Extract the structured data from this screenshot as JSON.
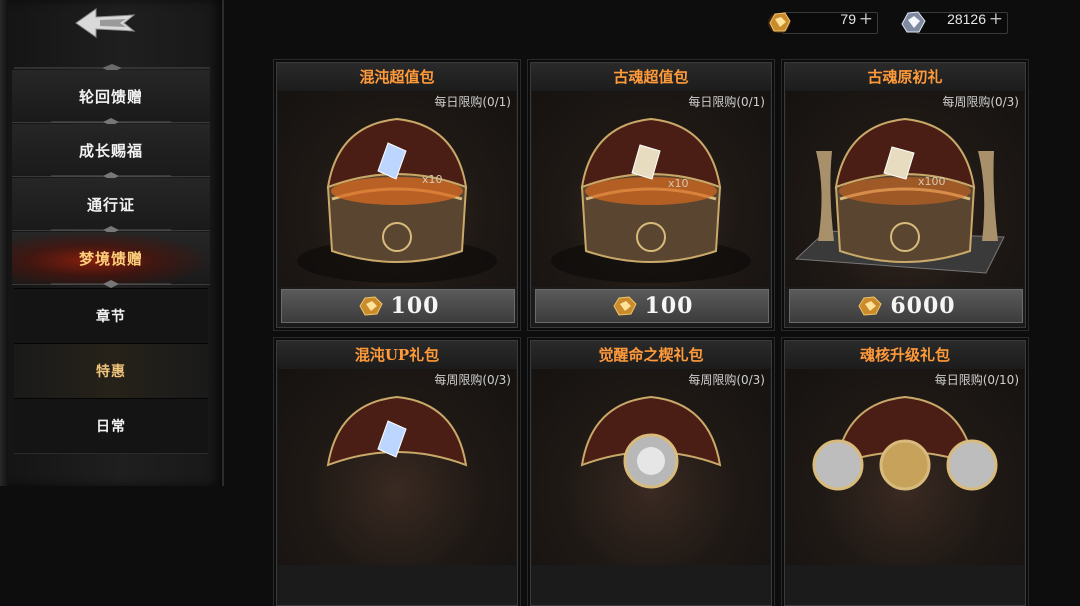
{
  "sidebar": {
    "items": [
      {
        "label": "轮回馈赠"
      },
      {
        "label": "成长赐福"
      },
      {
        "label": "通行证"
      },
      {
        "label": "梦境馈赠"
      },
      {
        "label": "章节"
      },
      {
        "label": "特惠"
      },
      {
        "label": "日常"
      }
    ],
    "active_item": "梦境馈赠",
    "selected_subitem": "特惠"
  },
  "currency": {
    "gold": {
      "value": "79",
      "plus": "+",
      "icon": "gold-ore-icon"
    },
    "crystal": {
      "value": "28126",
      "plus": "+",
      "icon": "crystal-icon"
    }
  },
  "packs": [
    {
      "title": "混沌超值包",
      "limit": "每日限购(0/1)",
      "price": "100",
      "qty": "x10",
      "icon": "gold-ore-icon"
    },
    {
      "title": "古魂超值包",
      "limit": "每日限购(0/1)",
      "price": "100",
      "qty": "x10",
      "icon": "gold-ore-icon"
    },
    {
      "title": "古魂原初礼",
      "limit": "每周限购(0/3)",
      "price": "6000",
      "qty": "x100",
      "icon": "gold-ore-icon"
    },
    {
      "title": "混沌UP礼包",
      "limit": "每周限购(0/3)"
    },
    {
      "title": "觉醒命之楔礼包",
      "limit": "每周限购(0/3)"
    },
    {
      "title": "魂核升级礼包",
      "limit": "每日限购(0/10)"
    }
  ],
  "colors": {
    "title": "#ff9a3a",
    "active_nav": "#ffcf7a",
    "background": "#0d0d0d"
  }
}
